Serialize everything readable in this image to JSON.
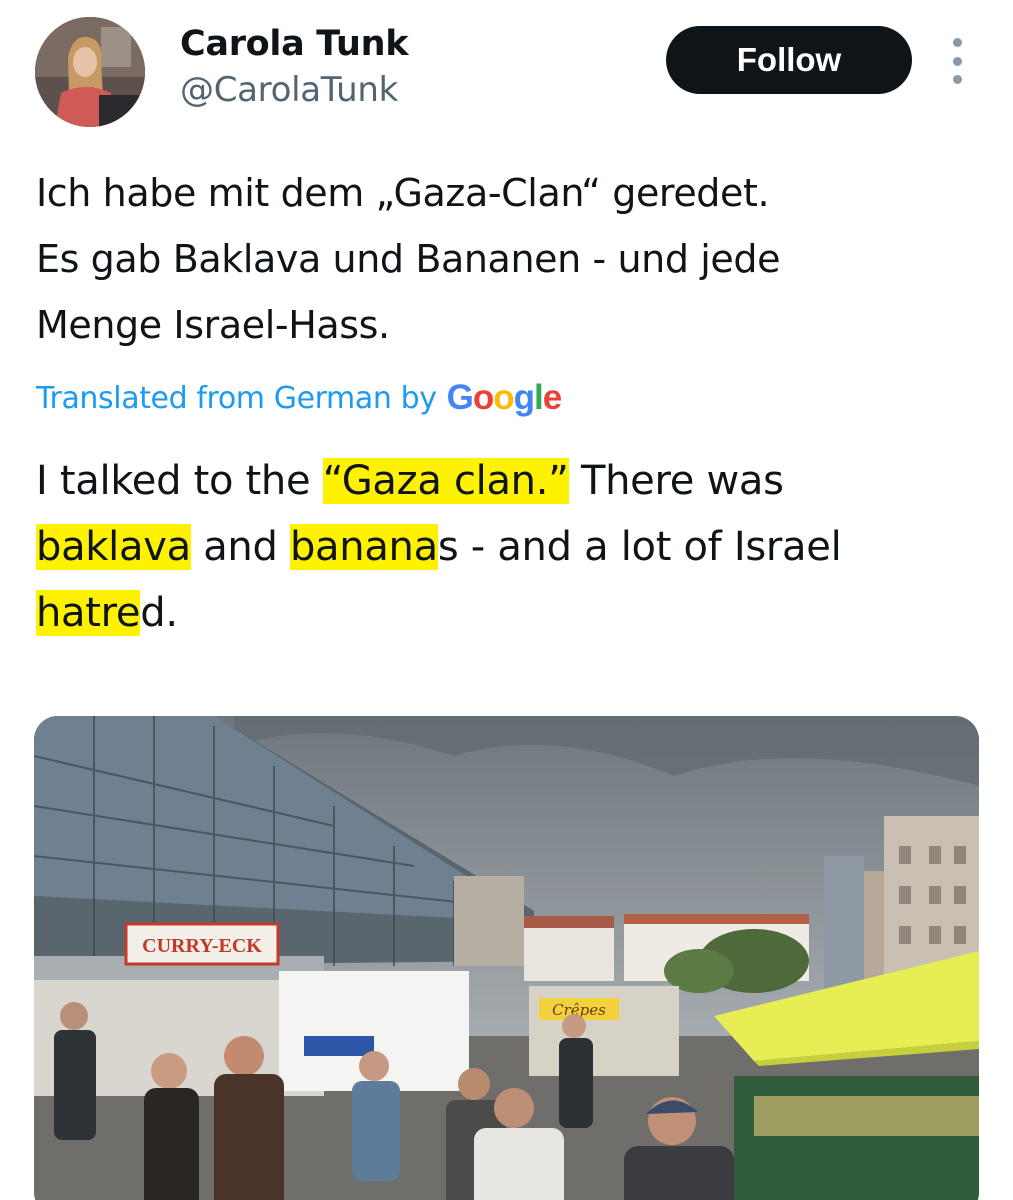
{
  "author": {
    "display_name": "Carola Tunk",
    "handle": "@CarolaTunk"
  },
  "follow_label": "Follow",
  "tweet": {
    "original_lines": [
      "Ich habe mit dem „Gaza-Clan“ geredet.",
      "Es gab Baklava und Bananen - und jede",
      "Menge Israel-Hass."
    ],
    "translated_label": "Translated from German by",
    "translator_brand": "Google",
    "translation": {
      "l1_pre": "I talked to the ",
      "l1_hl": "“Gaza clan.”",
      "l1_post": " There was",
      "l2_hl1": "baklava",
      "l2_mid": " and ",
      "l2_hl2": "banana",
      "l2_post": "s - and a lot of Israel",
      "l3_hl": "hatre",
      "l3_post": "d."
    }
  },
  "photo": {
    "signs": {
      "curry": "CURRY-ECK",
      "crepes": "Crêpes"
    },
    "colors": {
      "sky": "#8f979d",
      "awning": "#e6ee54",
      "highlight": "#fff200"
    }
  },
  "colors": {
    "link_blue": "#1d9bf0",
    "text": "#0f1419",
    "secondary": "#536471",
    "follow_bg": "#0f1419",
    "google_blue": "#4285f4",
    "google_red": "#ea4335",
    "google_yellow": "#fbbc05",
    "google_green": "#34a853"
  }
}
